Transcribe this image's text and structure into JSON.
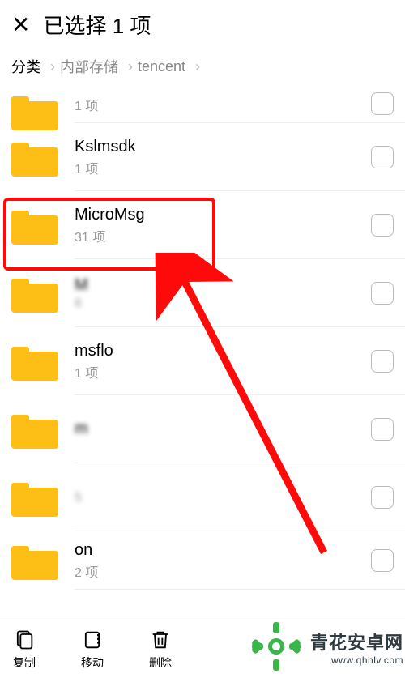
{
  "header": {
    "title": "已选择 1 项"
  },
  "breadcrumb": {
    "items": [
      "分类",
      "内部存储",
      "tencent"
    ]
  },
  "list": {
    "items": [
      {
        "name": "",
        "sub": "1 项",
        "truncatedTop": true
      },
      {
        "name": "Kslmsdk",
        "sub": "1 项"
      },
      {
        "name": "MicroMsg",
        "sub": "31 项",
        "highlight": true
      },
      {
        "name": "M",
        "sub": "6",
        "blur": true
      },
      {
        "name": "msflo",
        "sub": "1 项",
        "partialBlur": true
      },
      {
        "name": "m",
        "sub": "",
        "blur": true
      },
      {
        "name": "",
        "sub": "5",
        "blur": true
      },
      {
        "name": "on",
        "sub": "2 项",
        "partialBlur": true
      }
    ]
  },
  "bottombar": {
    "copy": "复制",
    "move": "移动",
    "delete": "删除"
  },
  "watermark": {
    "chinese": "青花安卓网",
    "url": "www.qhhlv.com"
  }
}
